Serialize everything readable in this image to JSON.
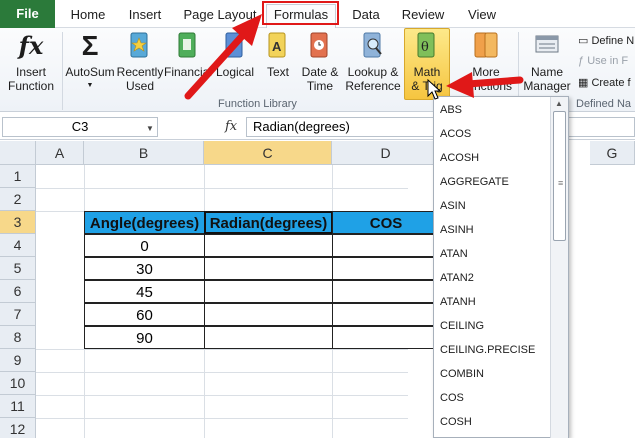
{
  "tabs": [
    "File",
    "Home",
    "Insert",
    "Page Layout",
    "Formulas",
    "Data",
    "Review",
    "View"
  ],
  "ribbon": {
    "insert_function": [
      "Insert",
      "Function"
    ],
    "autosum": "AutoSum",
    "recently_used": [
      "Recently",
      "Used"
    ],
    "financial": "Financial",
    "logical": "Logical",
    "text": "Text",
    "date_time": [
      "Date &",
      "Time"
    ],
    "lookup_reference": [
      "Lookup &",
      "Reference"
    ],
    "math_trig": [
      "Math",
      "& Trig"
    ],
    "more_functions": [
      "More",
      "Functions"
    ],
    "name_manager": [
      "Name",
      "Manager"
    ],
    "group_function_library": "Function Library",
    "define_name": "Define N",
    "use_in_formula": "Use in F",
    "create_from": "Create f",
    "group_defined_names": "Defined Na"
  },
  "formula_bar": {
    "name_box": "C3",
    "fx": "fx",
    "formula": "Radian(degrees)"
  },
  "columns": [
    "A",
    "B",
    "C",
    "D",
    "G"
  ],
  "rows": [
    "1",
    "2",
    "3",
    "4",
    "5",
    "6",
    "7",
    "8",
    "9",
    "10",
    "11",
    "12"
  ],
  "table": {
    "headers": [
      "Angle(degrees)",
      "Radian(degrees)",
      "COS"
    ],
    "angles": [
      "0",
      "30",
      "45",
      "60",
      "90"
    ]
  },
  "dropdown_items": [
    "ABS",
    "ACOS",
    "ACOSH",
    "AGGREGATE",
    "ASIN",
    "ASINH",
    "ATAN",
    "ATAN2",
    "ATANH",
    "CEILING",
    "CEILING.PRECISE",
    "COMBIN",
    "COS",
    "COSH"
  ],
  "colors": {
    "file_tab": "#2b7a3a",
    "header_fill": "#1fa1e6",
    "highlight": "#e01818",
    "math_button": "#f6c540"
  }
}
